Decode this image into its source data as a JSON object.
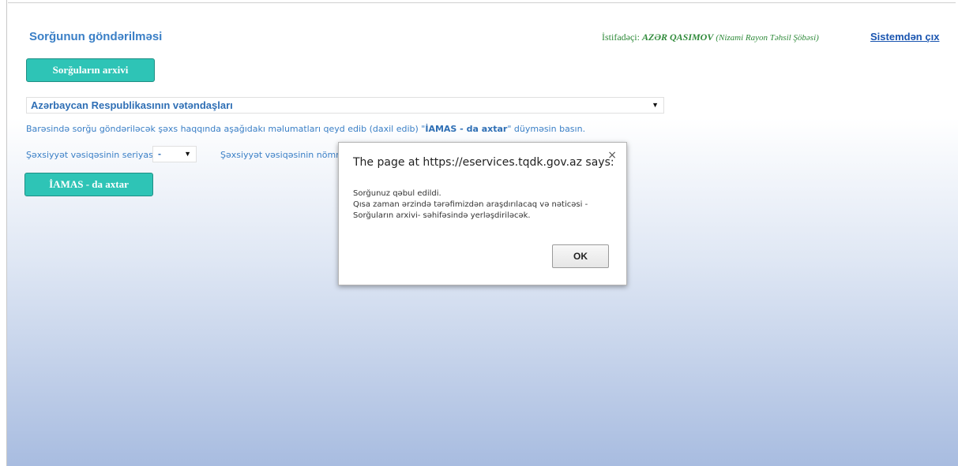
{
  "header": {
    "title": "Sorğunun göndərilməsi",
    "user_prefix": "İstifadəçi:",
    "user_name": "AZƏR QASIMOV",
    "user_department": "(Nizami Rayon Təhsil Şöbəsi)",
    "logout_label": "Sistemdən çıx"
  },
  "toolbar": {
    "archive_label": "Sorğuların arxivi"
  },
  "form": {
    "citizenship_selected": "Azərbaycan Respublikasının vətəndaşları",
    "instruction_pre": "Barəsində sorğu göndəriləcək şəxs haqqında aşağıdakı məlumatları qeyd edib (daxil edib) \"",
    "instruction_button_ref": "İAMAS - da axtar",
    "instruction_post": "\" düyməsin basın.",
    "series_label": "Şəxsiyyət vəsiqəsinin seriyası",
    "series_selected": "-",
    "number_label": "Şəxsiyyət vəsiqəsinin nömrəsi",
    "search_label": "İAMAS - da axtar"
  },
  "dialog": {
    "title": "The page at https://eservices.tqdk.gov.az says:",
    "close_glyph": "×",
    "message_line1": "Sorğunuz qəbul edildi.",
    "message_line2": "Qısa zaman ərzində tərəfimizdən araşdırılacaq və nəticəsi -",
    "message_line3": "Sorğuların arxivi- səhifəsində yerləşdiriləcək.",
    "ok_label": "OK"
  },
  "icons": {
    "dropdown_arrow": "▼"
  },
  "colors": {
    "accent_teal": "#2ec4b6",
    "link_blue": "#1a55b0",
    "text_blue": "#3a7fc6",
    "user_green": "#2f8a3a"
  }
}
